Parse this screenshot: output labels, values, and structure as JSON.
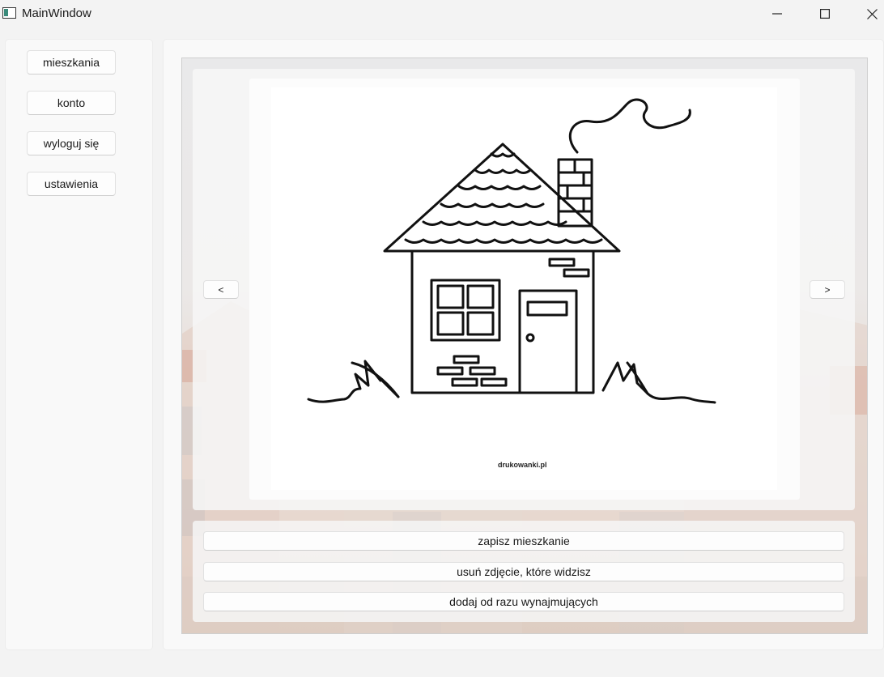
{
  "window": {
    "title": "MainWindow"
  },
  "sidebar": {
    "items": [
      {
        "label": "mieszkania"
      },
      {
        "label": "konto"
      },
      {
        "label": "wyloguj się"
      },
      {
        "label": "ustawienia"
      }
    ]
  },
  "viewer": {
    "prev_label": "<",
    "next_label": ">",
    "image_watermark": "drukowanki.pl"
  },
  "actions": {
    "save_label": "zapisz mieszkanie",
    "delete_label": "usuń zdjęcie, które widzisz",
    "add_label": "dodaj od razu wynajmujących"
  },
  "icons": {
    "minimize": "minimize-icon",
    "maximize": "maximize-icon",
    "close": "close-icon",
    "app": "app-window-icon"
  }
}
